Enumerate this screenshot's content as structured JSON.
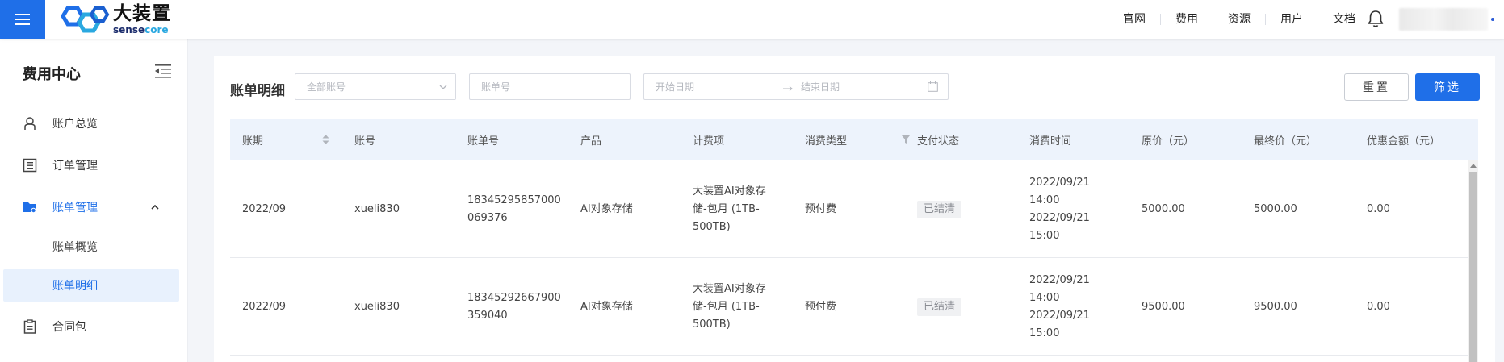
{
  "brand": {
    "name_cn": "大装置",
    "name_en_a": "sense",
    "name_en_b": "core",
    "primary": "#1f6fe8"
  },
  "top_nav": [
    "官网",
    "费用",
    "资源",
    "用户",
    "文档"
  ],
  "sidebar": {
    "title": "费用中心",
    "items": [
      {
        "label": "账户总览",
        "icon": "user-icon"
      },
      {
        "label": "订单管理",
        "icon": "list-icon"
      },
      {
        "label": "账单管理",
        "icon": "folder-icon"
      },
      {
        "label": "账单概览"
      },
      {
        "label": "账单明细"
      },
      {
        "label": "合同包",
        "icon": "clipboard-icon"
      }
    ]
  },
  "filters": {
    "title": "账单明细",
    "account_placeholder": "全部账号",
    "billno_placeholder": "账单号",
    "start_date_placeholder": "开始日期",
    "end_date_placeholder": "结束日期",
    "reset_label": "重置",
    "filter_label": "筛选"
  },
  "table": {
    "headers": [
      "账期",
      "账号",
      "账单号",
      "产品",
      "计费项",
      "消费类型",
      "支付状态",
      "消费时间",
      "原价（元）",
      "最终价（元）",
      "优惠金额（元）"
    ],
    "rows": [
      {
        "period": "2022/09",
        "account": "xueli830",
        "billno": "18345295857000\n69376",
        "billno_display": "18345295857000\n069376",
        "product": "AI对象存储",
        "item": "大装置AI对象存\n储-包月 (1TB-\n500TB)",
        "type": "预付费",
        "status": "已结清",
        "time": "2022/09/21\n14:00\n2022/09/21\n15:00",
        "original": "5000.00",
        "final": "5000.00",
        "discount": "0.00"
      },
      {
        "period": "2022/09",
        "account": "xueli830",
        "billno": "18345292667900\n59040",
        "billno_display": "18345292667900\n359040",
        "product": "AI对象存储",
        "item": "大装置AI对象存\n储-包月 (1TB-\n500TB)",
        "type": "预付费",
        "status": "已结清",
        "time": "2022/09/21\n14:00\n2022/09/21\n15:00",
        "original": "9500.00",
        "final": "9500.00",
        "discount": "0.00"
      }
    ]
  }
}
